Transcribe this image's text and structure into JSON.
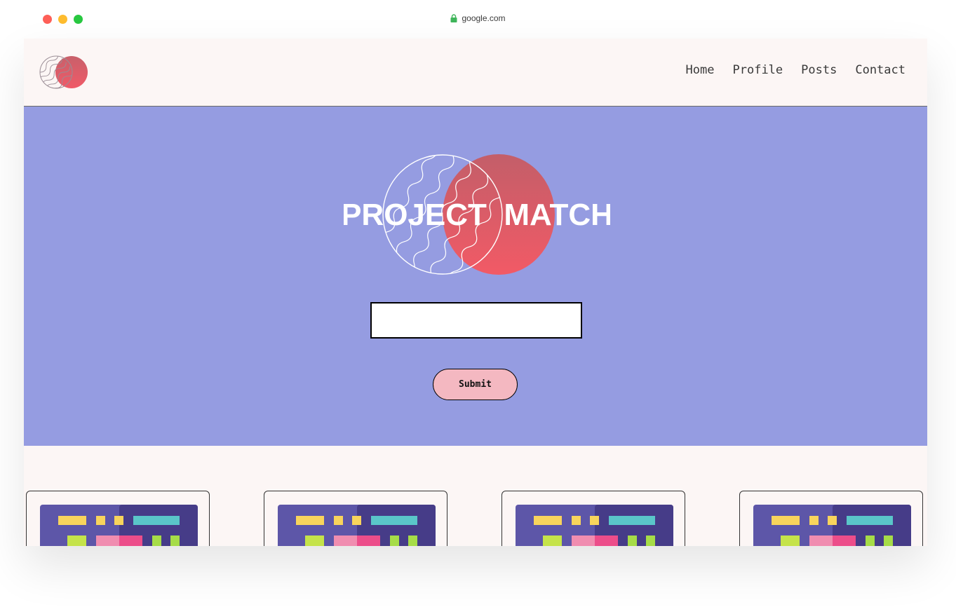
{
  "browser": {
    "url": "google.com"
  },
  "nav": {
    "links": [
      "Home",
      "Profile",
      "Posts",
      "Contact"
    ]
  },
  "hero": {
    "logo_text": "PROJECT  MATCH",
    "search_value": "",
    "submit_label": "Submit"
  },
  "cards": [
    {
      "thumb": "project-thumbnail-icon"
    },
    {
      "thumb": "project-thumbnail-icon"
    },
    {
      "thumb": "project-thumbnail-icon"
    },
    {
      "thumb": "project-thumbnail-icon"
    }
  ],
  "colors": {
    "page_bg": "#fcf6f5",
    "hero_bg": "#959ce1",
    "accent_red": "#ec5a66",
    "button_pink": "#f4b8c1"
  }
}
